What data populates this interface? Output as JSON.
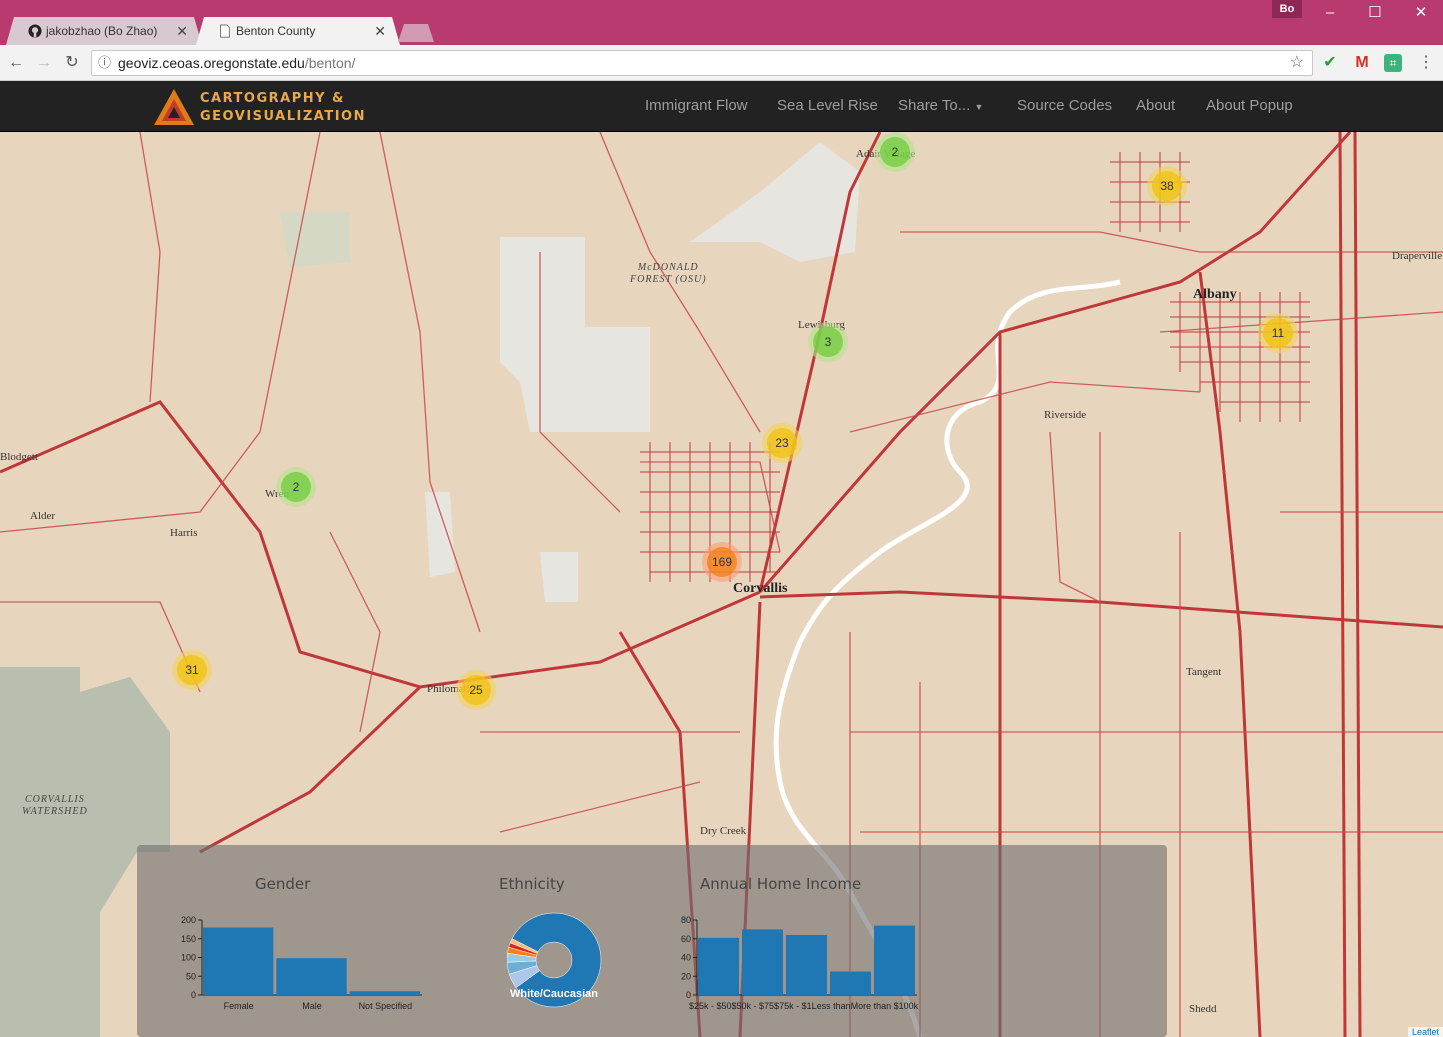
{
  "browser": {
    "tabs": [
      {
        "label": "jakobzhao (Bo Zhao)",
        "icon": "github-icon",
        "active": false
      },
      {
        "label": "Benton County",
        "icon": "page-icon",
        "active": true
      }
    ],
    "profile": "Bo",
    "url_host": "geoviz.ceoas.oregonstate.edu",
    "url_path": "/benton/",
    "window_controls": [
      "minimize-icon",
      "maximize-icon",
      "close-icon"
    ],
    "colors": {
      "titlebar": "#b83a6e"
    }
  },
  "site": {
    "logo_line1": "CARTOGRAPHY &",
    "logo_line2": "GEOVISUALIZATION",
    "nav": [
      "Immigrant Flow",
      "Sea Level Rise",
      "Share To...",
      "Source Codes",
      "About",
      "About Popup"
    ]
  },
  "map": {
    "places": [
      "Adair Village",
      "McDONALD",
      "FOREST (OSU)",
      "Lewisburg",
      "Albany",
      "Draperville",
      "Riverside",
      "Blodgett",
      "Alder",
      "Harris",
      "Wren",
      "Corvallis",
      "Philomath",
      "Tangent",
      "CORVALLIS",
      "WATERSHED",
      "Dry Creek",
      "Shedd"
    ],
    "clusters": [
      {
        "count": "2",
        "level": "green"
      },
      {
        "count": "38",
        "level": "yellow"
      },
      {
        "count": "3",
        "level": "green"
      },
      {
        "count": "11",
        "level": "yellow"
      },
      {
        "count": "23",
        "level": "yellow"
      },
      {
        "count": "2",
        "level": "green"
      },
      {
        "count": "169",
        "level": "orange"
      },
      {
        "count": "31",
        "level": "yellow"
      },
      {
        "count": "25",
        "level": "yellow"
      }
    ],
    "attribution": "Leaflet"
  },
  "charts_panel": {
    "gender_title": "Gender",
    "ethnicity_title": "Ethnicity",
    "income_title": "Annual Home Income"
  },
  "chart_data": [
    {
      "type": "bar",
      "title": "Gender",
      "categories": [
        "Female",
        "Male",
        "Not Specified"
      ],
      "values": [
        180,
        98,
        10
      ],
      "yticks": [
        "0",
        "50",
        "100",
        "150",
        "200"
      ],
      "ylim": [
        0,
        200
      ],
      "color": "#1f77b4"
    },
    {
      "type": "pie",
      "title": "Ethnicity",
      "donut": true,
      "center_label": "White/Caucasian",
      "slices": [
        {
          "value": 80,
          "color": "#1f77b4"
        },
        {
          "value": 5,
          "color": "#aec7e8"
        },
        {
          "value": 4,
          "color": "#6baed6"
        },
        {
          "value": 3,
          "color": "#9ecae1"
        },
        {
          "value": 2,
          "color": "#ff7f0e"
        },
        {
          "value": 1.5,
          "color": "#d62728"
        },
        {
          "value": 1.5,
          "color": "#ffbb78"
        }
      ]
    },
    {
      "type": "bar",
      "title": "Annual Home Income",
      "categories": [
        "$25k - $50k",
        "$50k - $75k",
        "$75k - $100k",
        "Less than $25k",
        "More than $100k"
      ],
      "tick_text": "$25k - $50$50k - $75$75k - $1Less thanMore than $100k",
      "values": [
        61,
        70,
        64,
        25,
        74
      ],
      "yticks": [
        "0",
        "20",
        "40",
        "60",
        "80"
      ],
      "ylim": [
        0,
        80
      ],
      "color": "#1f77b4"
    }
  ]
}
